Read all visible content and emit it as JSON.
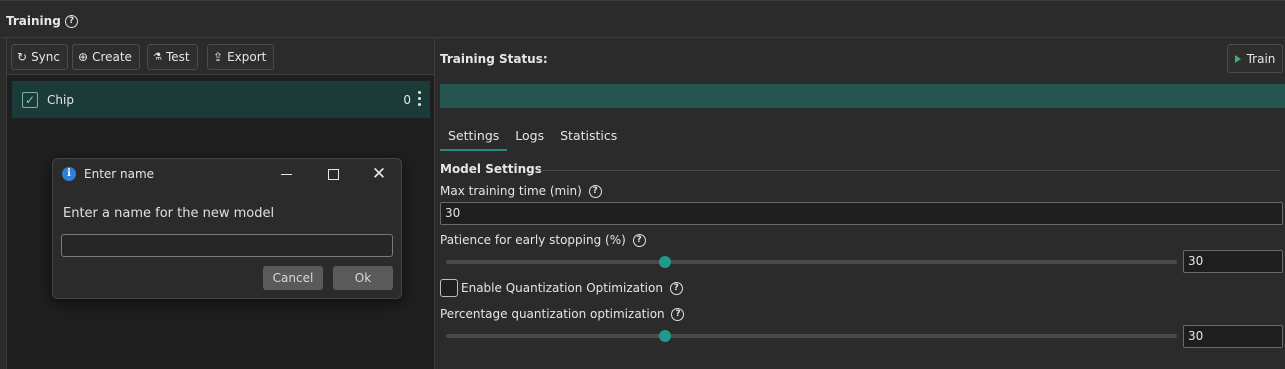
{
  "panel": {
    "title": "Training"
  },
  "toolbar": {
    "sync": {
      "icon": "refresh-icon",
      "label": "Sync"
    },
    "create": {
      "icon": "plus-circle-icon",
      "label": "Create"
    },
    "test": {
      "icon": "flask-icon",
      "label": "Test"
    },
    "export": {
      "icon": "export-icon",
      "label": "Export"
    }
  },
  "models": [
    {
      "name": "Chip",
      "count": "0",
      "checked": true
    }
  ],
  "status": {
    "label": "Training Status:",
    "train_button": "Train"
  },
  "tabs": [
    "Settings",
    "Logs",
    "Statistics"
  ],
  "settings": {
    "section_title": "Model Settings",
    "max_time_label": "Max training time (min)",
    "max_time_value": "30",
    "patience_label": "Patience for early stopping (%)",
    "patience_value": "30",
    "patience_slider": 0.3,
    "quant_enable_label": "Enable Quantization Optimization",
    "quant_enabled": false,
    "quant_pct_label": "Percentage quantization optimization",
    "quant_pct_value": "30",
    "quant_pct_slider": 0.3
  },
  "dialog": {
    "title": "Enter name",
    "message": "Enter a name for the new model",
    "input_value": "",
    "cancel": "Cancel",
    "ok": "Ok"
  },
  "colors": {
    "accent": "#1f9a8b",
    "selected_row": "#1b3b38",
    "progress": "#26544f"
  }
}
